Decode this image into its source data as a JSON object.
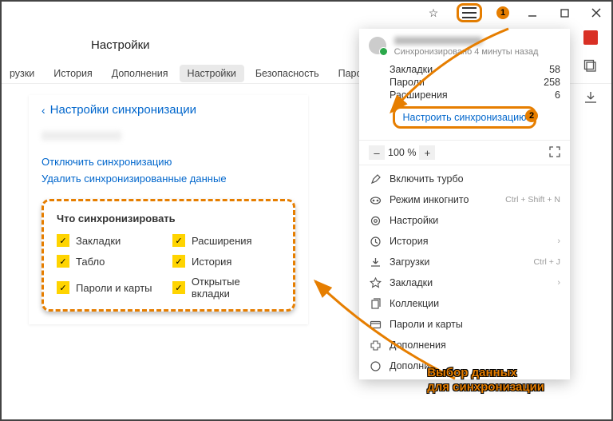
{
  "window": {
    "bookmark_icon": "☆"
  },
  "callouts": {
    "one": "1",
    "two": "2"
  },
  "page": {
    "title": "Настройки"
  },
  "tabs": {
    "items": [
      {
        "label": "рузки"
      },
      {
        "label": "История"
      },
      {
        "label": "Дополнения"
      },
      {
        "label": "Настройки"
      },
      {
        "label": "Безопасность"
      },
      {
        "label": "Паро"
      }
    ],
    "active_index": 3
  },
  "section": {
    "back_chev": "‹",
    "title": "Настройки синхронизации",
    "links": {
      "disable": "Отключить синхронизацию",
      "delete": "Удалить синхронизированные данные"
    }
  },
  "sync_box": {
    "heading": "Что синхронизировать",
    "items": [
      {
        "label": "Закладки"
      },
      {
        "label": "Расширения"
      },
      {
        "label": "Табло"
      },
      {
        "label": "История"
      },
      {
        "label": "Пароли и карты"
      },
      {
        "label": "Открытые вкладки"
      }
    ]
  },
  "menu": {
    "sync_time": "Синхронизировано 4 минуты назад",
    "stats": [
      {
        "label": "Закладки",
        "value": "58"
      },
      {
        "label": "Пароли",
        "value": "258"
      },
      {
        "label": "Расширения",
        "value": "6"
      }
    ],
    "configure": "Настроить синхронизацию",
    "zoom": {
      "minus": "–",
      "value": "100 %",
      "plus": "+"
    },
    "items": [
      {
        "icon": "rocket",
        "label": "Включить турбо"
      },
      {
        "icon": "mask",
        "label": "Режим инкогнито",
        "hint": "Ctrl + Shift + N"
      },
      {
        "icon": "gear",
        "label": "Настройки"
      },
      {
        "icon": "clock",
        "label": "История",
        "chev": "›"
      },
      {
        "icon": "download",
        "label": "Загрузки",
        "hint": "Ctrl + J"
      },
      {
        "icon": "star",
        "label": "Закладки",
        "chev": "›"
      },
      {
        "icon": "copy",
        "label": "Коллекции"
      },
      {
        "icon": "card",
        "label": "Пароли и карты"
      },
      {
        "icon": "puzzle",
        "label": "Дополнения"
      },
      {
        "icon": "more",
        "label": "Дополни"
      }
    ]
  },
  "annotation": {
    "line1": "Выбор данных",
    "line2": "для синхронизации"
  }
}
